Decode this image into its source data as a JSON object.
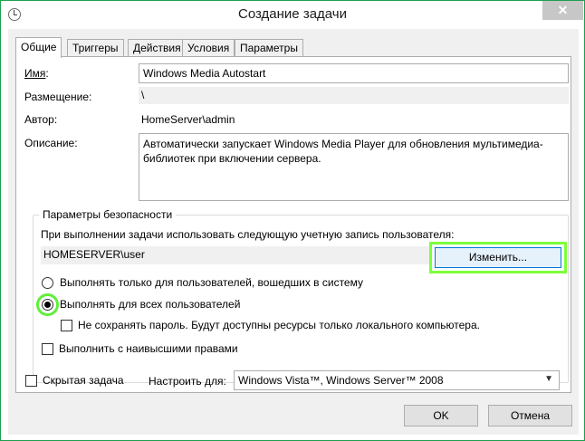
{
  "window": {
    "title": "Создание задачи",
    "close_glyph": "✕"
  },
  "tabs": [
    {
      "label": "Общие",
      "active": true
    },
    {
      "label": "Триггеры",
      "active": false
    },
    {
      "label": "Действия",
      "active": false
    },
    {
      "label": "Условия",
      "active": false
    },
    {
      "label": "Параметры",
      "active": false
    }
  ],
  "general": {
    "name_label": "Имя",
    "name_colon": ":",
    "name_value": "Windows Media Autostart",
    "location_label": "Размещение:",
    "location_value": "\\",
    "author_label": "Автор:",
    "author_value": "HomeServer\\admin",
    "description_label": "Описание:",
    "description_lines": [
      "Автоматически запускает Windows Media Player для обновления мультимедиа-",
      "библиотек при включении сервера."
    ]
  },
  "security": {
    "group_title": "Параметры безопасности",
    "run_as_text": "При выполнении задачи использовать следующую учетную запись пользователя:",
    "user_account": "HOMESERVER\\user",
    "change_button": "Изменить...",
    "radio_logged_on": "Выполнять только для пользователей, вошедших в систему",
    "radio_all_users": "Выполнять для всех пользователей",
    "selected_radio": "all_users",
    "no_store_password": "Не сохранять пароль. Будут доступны ресурсы только локального компьютера.",
    "highest_privileges": "Выполнить с наивысшими правами"
  },
  "footer": {
    "hidden_task": "Скрытая задача",
    "configure_for_label": "Настроить для:",
    "configure_for_value": "Windows Vista™, Windows Server™ 2008",
    "ok_button": "OK",
    "cancel_button": "Отмена"
  },
  "colors": {
    "highlight": "#5fef3a",
    "window_border": "#1e9e4f"
  }
}
